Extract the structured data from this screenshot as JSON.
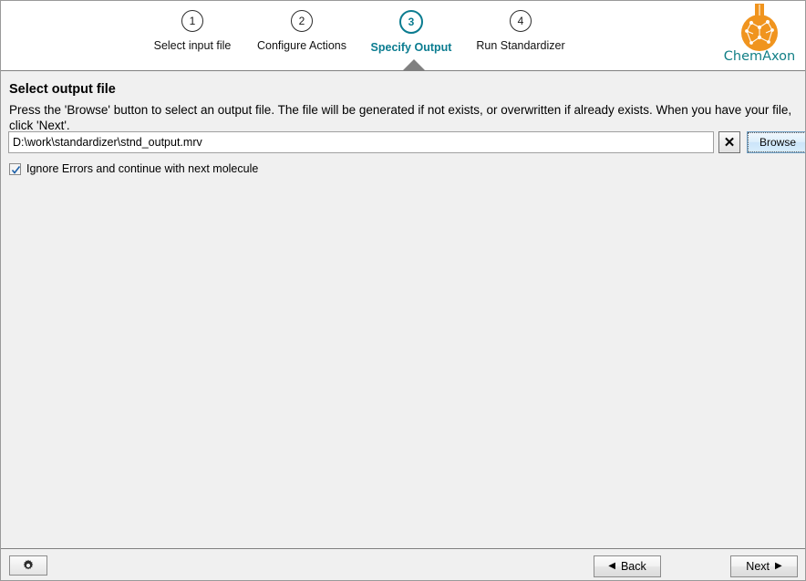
{
  "header": {
    "steps": [
      {
        "number": "1",
        "label": "Select input file",
        "active": false
      },
      {
        "number": "2",
        "label": "Configure Actions",
        "active": false
      },
      {
        "number": "3",
        "label": "Specify Output",
        "active": true
      },
      {
        "number": "4",
        "label": "Run Standardizer",
        "active": false
      }
    ],
    "logo_text": "ChemAxon",
    "logo_color": "#117f86",
    "logo_mark_color": "#f0941e",
    "active_color": "#0b7c90"
  },
  "content": {
    "title": "Select output file",
    "description": "Press the 'Browse' button to select an output file. The file will be generated if not exists, or overwritten if already exists. When you have your file, click 'Next'.",
    "file_field": {
      "value": "D:\\work\\standardizer\\stnd_output.mrv",
      "placeholder": ""
    },
    "clear_button_label": "✕",
    "browse_button_label": "Browse",
    "ignore_errors": {
      "label": "Ignore Errors and continue with next molecule",
      "checked": true
    }
  },
  "footer": {
    "settings_icon": "gear-icon",
    "back_label": "Back",
    "next_label": "Next",
    "back_arrow": "◀",
    "next_arrow": "▶"
  }
}
